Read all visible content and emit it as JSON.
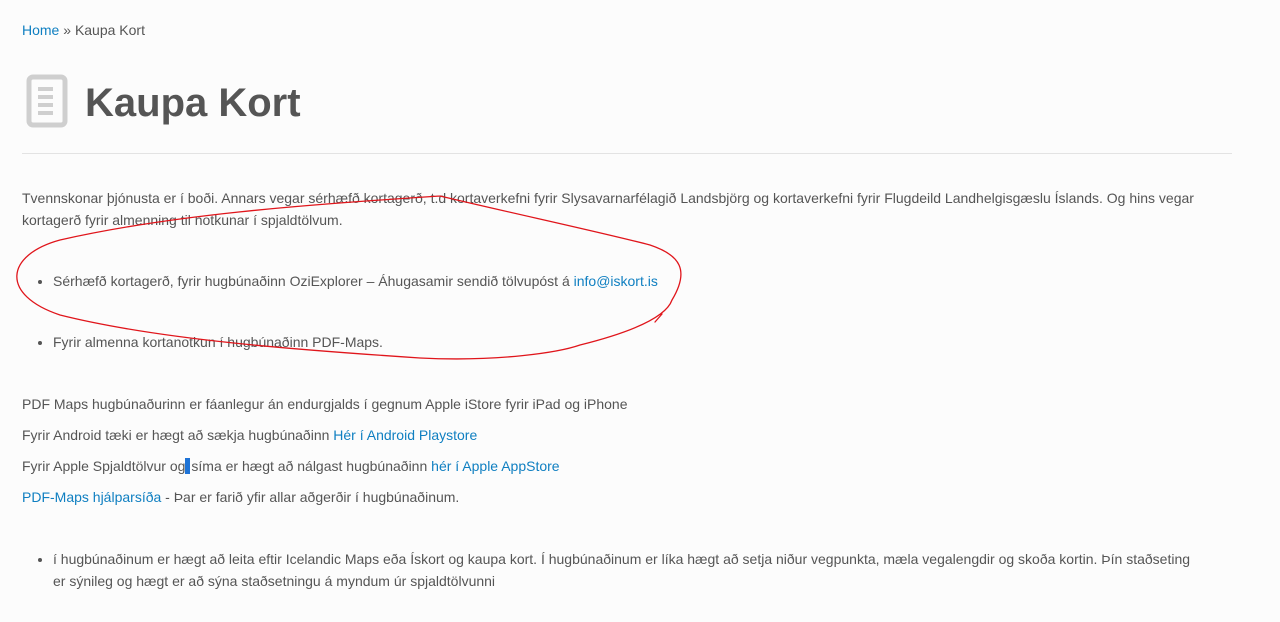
{
  "breadcrumb": {
    "home": "Home",
    "separator": "»",
    "current": "Kaupa Kort"
  },
  "page": {
    "icon": "document-icon",
    "title": "Kaupa Kort"
  },
  "intro": "Tvennskonar þjónusta er í boði. Annars vegar sérhæfð kortagerð,  t.d kortaverkefni fyrir Slysavarnarfélagið Landsbjörg og  kortaverkefni fyrir Flugdeild Landhelgisgæslu Íslands. Og hins vegar kortagerð fyrir almenning til notkunar í spjaldtölvum.",
  "bullet1": {
    "text": "Sérhæfð kortagerð, fyrir hugbúnaðinn OziExplorer – Áhugasamir sendið tölvupóst á ",
    "link": "info@iskort.is"
  },
  "bullet2": {
    "text": "Fyrir almenna kortanotkun  í hugbúnaðinn PDF-Maps."
  },
  "lines": {
    "pdfmaps": "PDF Maps hugbúnaðurinn er fáanlegur án endurgjalds í gegnum Apple iStore fyrir iPad og iPhone",
    "android_text": "Fyrir Android tæki  er hægt að sækja hugbúnaðinn ",
    "android_link": "Hér í Android Playstore",
    "apple_text_a": "Fyrir Apple Spjaldtölvur og",
    "apple_text_b": "síma er hægt að nálgast hugbúnaðinn ",
    "apple_link": "hér í Apple AppStore",
    "help_link": "PDF-Maps hjálparsíða",
    "help_text": " - Þar er farið yfir allar aðgerðir í hugbúnaðinum."
  },
  "bullet3": {
    "text": "í hugbúnaðinum er hægt að  leita eftir Icelandic Maps eða Ískort og kaupa kort. Í hugbúnaðinum er líka hægt að setja niður vegpunkta, mæla vegalengdir og skoða kortin. Þín staðseting er sýnileg og hægt er að sýna staðsetningu á myndum úr spjaldtölvunni"
  },
  "colors": {
    "link": "#0f7fc1",
    "text": "#555555",
    "annotation": "#e0151b",
    "cursor": "#1e73d6"
  }
}
